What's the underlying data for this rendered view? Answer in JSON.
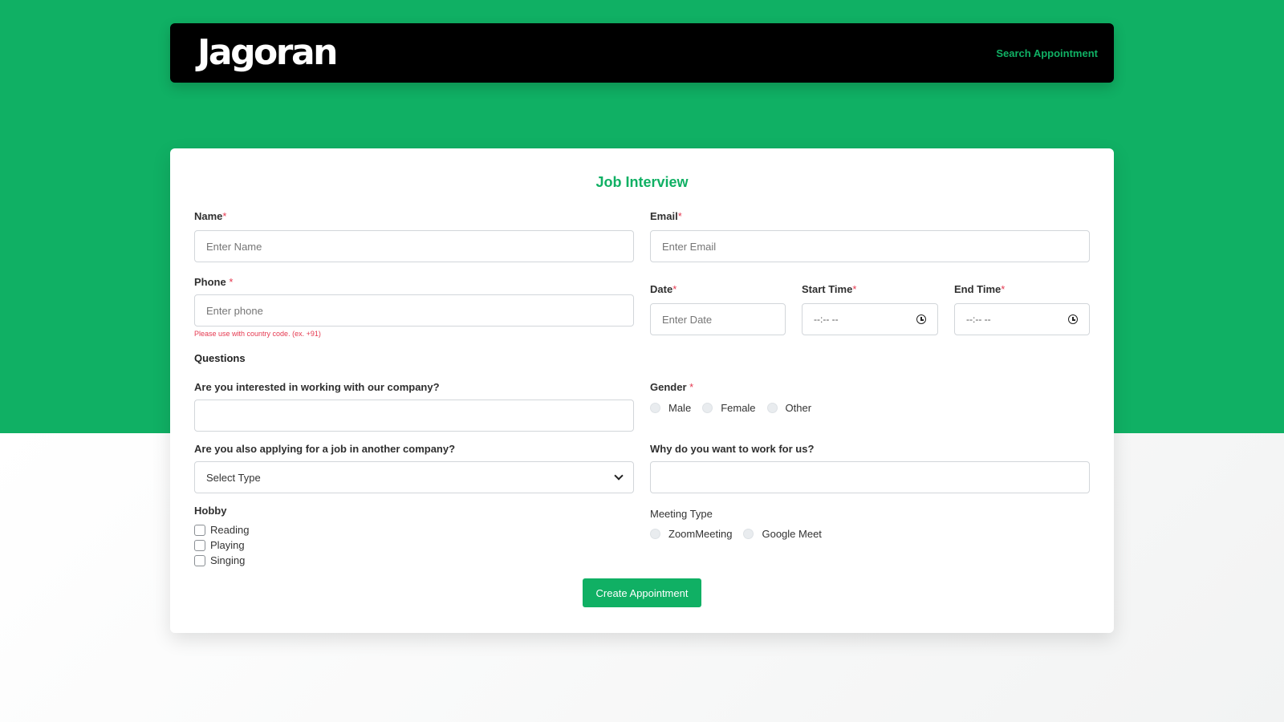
{
  "navbar": {
    "logo": "Jagoran",
    "search_link": "Search Appointment"
  },
  "form": {
    "title": "Job Interview",
    "name": {
      "label": "Name",
      "required": "*",
      "placeholder": "Enter Name"
    },
    "email": {
      "label": "Email",
      "required": "*",
      "placeholder": "Enter Email"
    },
    "phone": {
      "label": "Phone ",
      "required": "*",
      "placeholder": "Enter phone",
      "hint": "Please use with country code. (ex. +91)"
    },
    "date": {
      "label": "Date",
      "required": "*",
      "placeholder": "Enter Date"
    },
    "start_time": {
      "label": "Start Time",
      "required": "*",
      "value": "--:-- --"
    },
    "end_time": {
      "label": "End Time",
      "required": "*",
      "value": "--:-- --"
    },
    "questions_title": "Questions",
    "q_interested": {
      "label": "Are you interested in working with our company?",
      "value": ""
    },
    "gender": {
      "label": "Gender ",
      "required": "*",
      "options": [
        "Male",
        "Female",
        "Other"
      ]
    },
    "q_other_company": {
      "label": "Are you also applying for a job in another company?",
      "selected": "Select Type"
    },
    "q_why": {
      "label": "Why do you want to work for us?",
      "value": ""
    },
    "hobby": {
      "label": "Hobby",
      "options": [
        "Reading",
        "Playing",
        "Singing"
      ]
    },
    "meeting_type": {
      "label": "Meeting Type",
      "options": [
        "ZoomMeeting",
        "Google Meet"
      ]
    },
    "submit_label": "Create Appointment"
  },
  "colors": {
    "brand": "#10b064",
    "required": "#e53950",
    "navbar": "#000000"
  }
}
